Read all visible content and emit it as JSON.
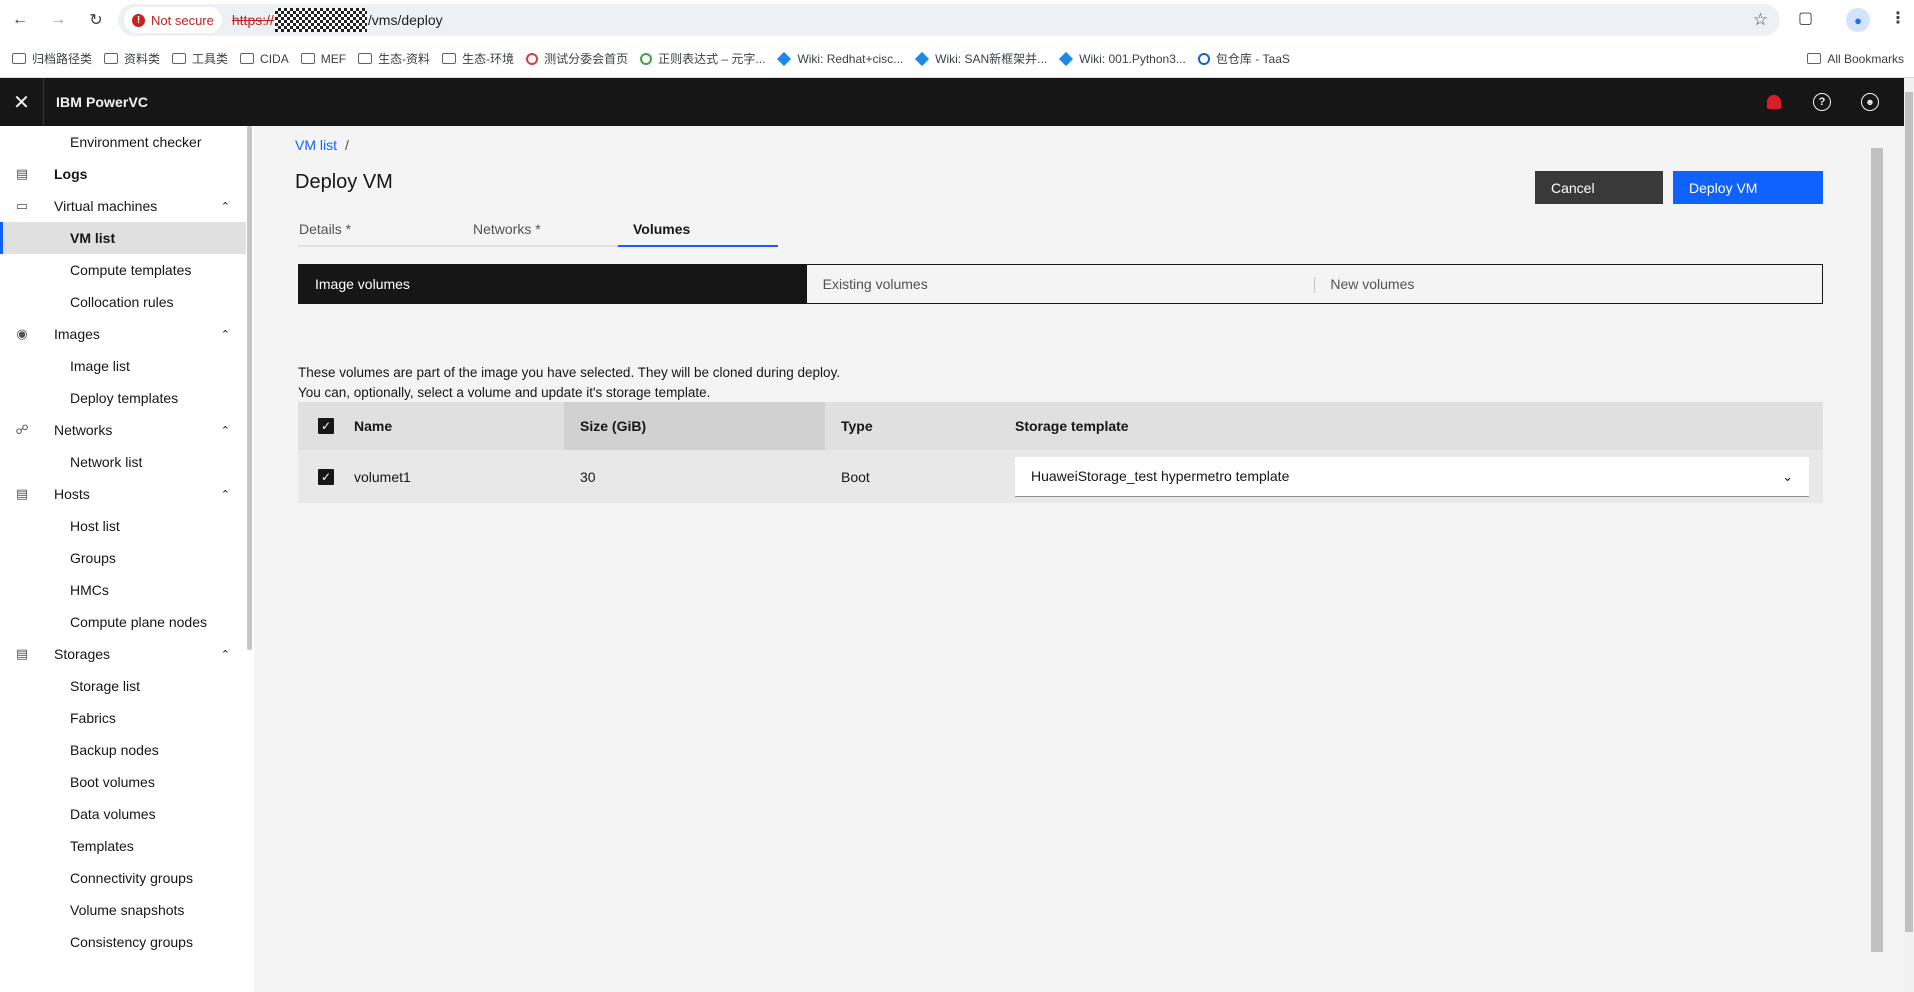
{
  "browser": {
    "security_label": "Not secure",
    "url_scheme": "https://",
    "url_path": "/vms/deploy",
    "bookmarks": [
      {
        "label": "归档路径类",
        "kind": "folder"
      },
      {
        "label": "资料类",
        "kind": "folder"
      },
      {
        "label": "工具类",
        "kind": "folder"
      },
      {
        "label": "CIDA",
        "kind": "folder"
      },
      {
        "label": "MEF",
        "kind": "folder"
      },
      {
        "label": "生态-资料",
        "kind": "folder"
      },
      {
        "label": "生态-环境",
        "kind": "folder"
      },
      {
        "label": "测试分委会首页",
        "kind": "site"
      },
      {
        "label": "正则表达式 – 元字...",
        "kind": "site"
      },
      {
        "label": "Wiki: Redhat+cisc...",
        "kind": "wiki"
      },
      {
        "label": "Wiki: SAN新框架并...",
        "kind": "wiki"
      },
      {
        "label": "Wiki: 001.Python3...",
        "kind": "wiki"
      },
      {
        "label": "包仓库 - TaaS",
        "kind": "site"
      }
    ],
    "all_bookmarks": "All Bookmarks"
  },
  "app": {
    "title": "IBM PowerVC"
  },
  "sidebar": {
    "items": [
      {
        "label": "Environment checker",
        "type": "sub"
      },
      {
        "label": "Logs",
        "type": "cat"
      },
      {
        "label": "Virtual machines",
        "type": "cat"
      },
      {
        "label": "VM list",
        "type": "sub"
      },
      {
        "label": "Compute templates",
        "type": "sub"
      },
      {
        "label": "Collocation rules",
        "type": "sub"
      },
      {
        "label": "Images",
        "type": "cat"
      },
      {
        "label": "Image list",
        "type": "sub"
      },
      {
        "label": "Deploy templates",
        "type": "sub"
      },
      {
        "label": "Networks",
        "type": "cat"
      },
      {
        "label": "Network list",
        "type": "sub"
      },
      {
        "label": "Hosts",
        "type": "cat"
      },
      {
        "label": "Host list",
        "type": "sub"
      },
      {
        "label": "Groups",
        "type": "sub"
      },
      {
        "label": "HMCs",
        "type": "sub"
      },
      {
        "label": "Compute plane nodes",
        "type": "sub"
      },
      {
        "label": "Storages",
        "type": "cat"
      },
      {
        "label": "Storage list",
        "type": "sub"
      },
      {
        "label": "Fabrics",
        "type": "sub"
      },
      {
        "label": "Backup nodes",
        "type": "sub"
      },
      {
        "label": "Boot volumes",
        "type": "sub"
      },
      {
        "label": "Data volumes",
        "type": "sub"
      },
      {
        "label": "Templates",
        "type": "sub"
      },
      {
        "label": "Connectivity groups",
        "type": "sub"
      },
      {
        "label": "Volume snapshots",
        "type": "sub"
      },
      {
        "label": "Consistency groups",
        "type": "sub"
      }
    ],
    "active": "VM list"
  },
  "main": {
    "breadcrumb": {
      "link": "VM list",
      "separator": "/"
    },
    "title": "Deploy VM",
    "buttons": {
      "cancel": "Cancel",
      "deploy": "Deploy VM"
    },
    "tabs": [
      {
        "label": "Details *",
        "active": false
      },
      {
        "label": "Networks *",
        "active": false
      },
      {
        "label": "Volumes",
        "active": true
      }
    ],
    "switcher": [
      {
        "label": "Image volumes",
        "selected": true
      },
      {
        "label": "Existing volumes",
        "selected": false
      },
      {
        "label": "New volumes",
        "selected": false
      }
    ],
    "description": [
      "These volumes are part of the image you have selected. They will be cloned during deploy.",
      "You can, optionally, select a volume and update it's storage template."
    ],
    "table": {
      "headers": [
        "Name",
        "Size (GiB)",
        "Type",
        "Storage template"
      ],
      "header_checked": true,
      "rows": [
        {
          "checked": true,
          "name": "volumet1",
          "size": "30",
          "type": "Boot",
          "storage_template": "HuaweiStorage_test hypermetro template"
        }
      ]
    }
  },
  "colors": {
    "accent": "#0f62fe",
    "header_bg": "#161616",
    "notification": "#da1e28",
    "not_secure": "#c5221f"
  },
  "icons": [
    "back-arrow-icon",
    "forward-arrow-icon",
    "reload-icon",
    "star-icon",
    "extensions-icon",
    "profile-icon",
    "menu-icon",
    "folder-icon",
    "close-icon",
    "notification-icon",
    "help-icon",
    "user-icon",
    "logs-icon",
    "monitor-icon",
    "camera-icon",
    "network-icon",
    "host-icon",
    "storage-icon",
    "chevron-up-icon",
    "chevron-down-icon",
    "checkmark-icon"
  ]
}
